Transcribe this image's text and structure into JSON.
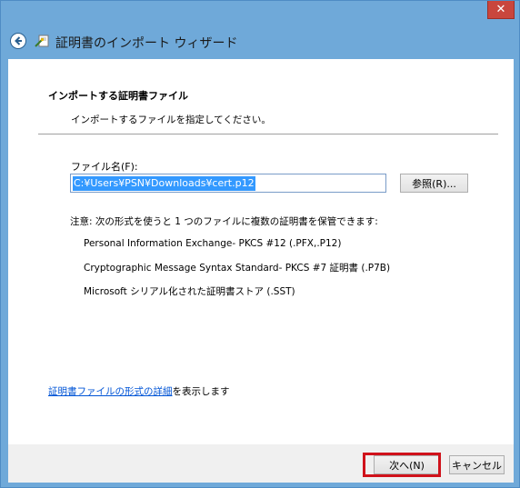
{
  "window": {
    "title": "証明書のインポート ウィザード",
    "close_glyph": "✕"
  },
  "page": {
    "section_title": "インポートする証明書ファイル",
    "section_desc": "インポートするファイルを指定してください。",
    "file_label": "ファイル名(F):",
    "file_value": "C:¥Users¥PSN¥Downloads¥cert.p12",
    "browse_label": "参照(R)...",
    "note": "注意: 次の形式を使うと 1 つのファイルに複数の証明書を保管できます:",
    "formats": [
      "Personal Information Exchange- PKCS #12 (.PFX,.P12)",
      "Cryptographic Message Syntax Standard- PKCS #7 証明書 (.P7B)",
      "Microsoft シリアル化された証明書ストア (.SST)"
    ],
    "link_text": "証明書ファイルの形式の詳細",
    "link_suffix": "を表示します"
  },
  "footer": {
    "next_label": "次へ(N)",
    "cancel_label": "キャンセル"
  },
  "colors": {
    "frame": "#6fa9d9",
    "highlight": "#d0121b",
    "link": "#0054d6"
  },
  "icons": [
    "back-arrow-icon",
    "certificate-wizard-icon",
    "close-icon"
  ]
}
